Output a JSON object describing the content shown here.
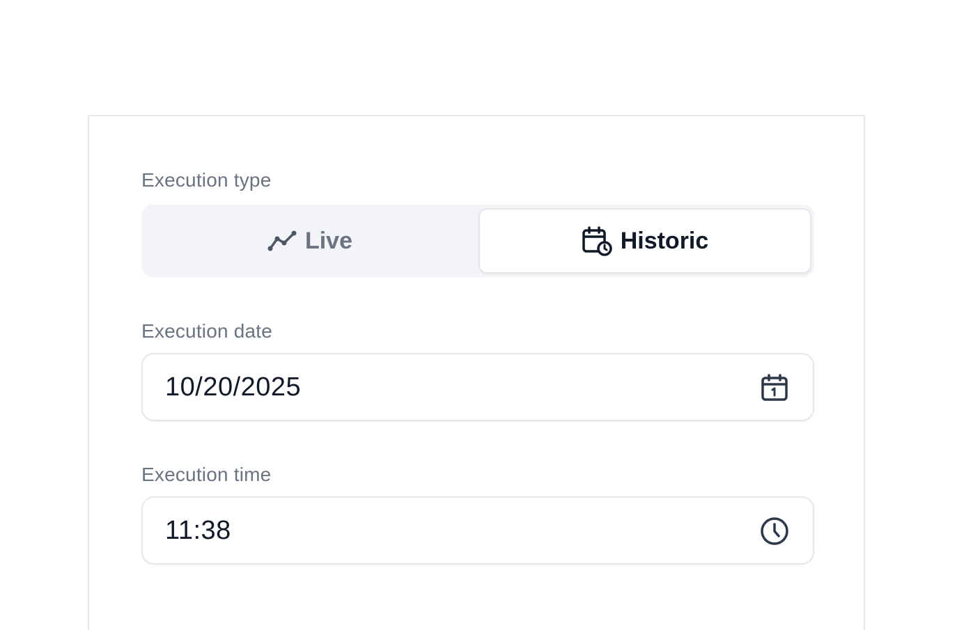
{
  "form": {
    "execution_type": {
      "label": "Execution type",
      "options": [
        {
          "label": "Live",
          "icon": "trend-line-icon",
          "selected": false
        },
        {
          "label": "Historic",
          "icon": "calendar-clock-icon",
          "selected": true
        }
      ]
    },
    "execution_date": {
      "label": "Execution date",
      "value": "10/20/2025",
      "icon": "calendar-icon"
    },
    "execution_time": {
      "label": "Execution time",
      "value": "11:38",
      "icon": "clock-icon"
    }
  },
  "colors": {
    "label": "#6b7280",
    "text": "#111827",
    "segment_bg": "#f3f4f7",
    "border": "#e5e7eb",
    "icon": "#2d3748"
  }
}
